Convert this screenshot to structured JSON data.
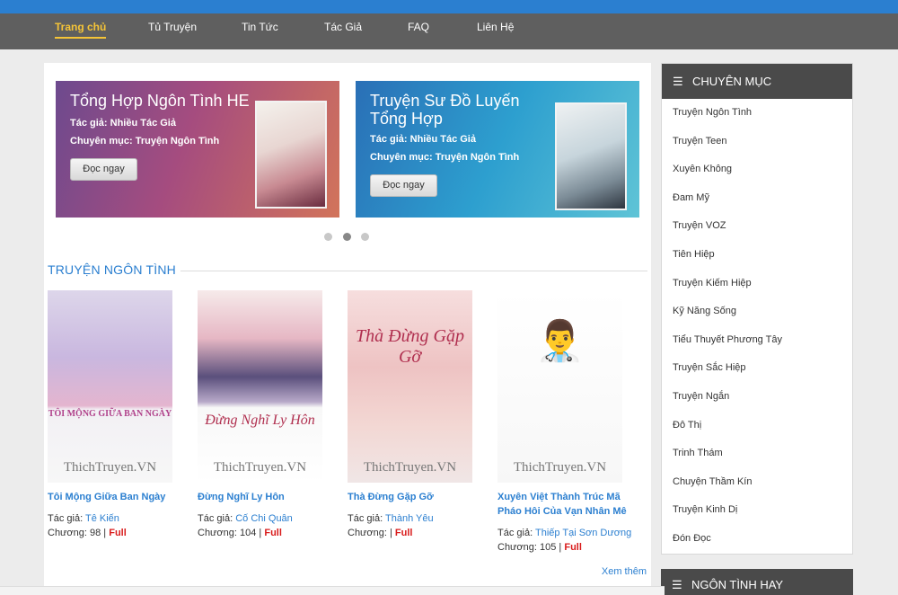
{
  "nav": {
    "items": [
      "Trang chủ",
      "Tủ Truyện",
      "Tin Tức",
      "Tác Giả",
      "FAQ",
      "Liên Hệ"
    ]
  },
  "slider": {
    "slides": [
      {
        "title": "Tổng Hợp Ngôn Tình HE",
        "author": "Tác giả: Nhiều Tác Giả",
        "category": "Chuyên mục: Truyện Ngôn Tình",
        "button": "Đọc ngay"
      },
      {
        "title": "Truyện Sư Đồ Luyến Tổng Hợp",
        "author": "Tác giả: Nhiều Tác Giả",
        "category": "Chuyên mục: Truyện Ngôn Tình",
        "button": "Đọc ngay"
      }
    ]
  },
  "section": {
    "title": "TRUYỆN NGÔN TÌNH",
    "more": "Xem thêm",
    "author_label": "Tác giả:",
    "chapter_label": "Chương:",
    "books": [
      {
        "title": "Tôi Mộng Giữa Ban Ngày",
        "author": "Tê Kiến",
        "chapters": "98",
        "status": "Full",
        "cover_text": "TÔI MỘNG GIỮA BAN NGÀY"
      },
      {
        "title": "Đừng Nghĩ Ly Hôn",
        "author": "Cố Chi Quân",
        "chapters": "104",
        "status": "Full",
        "cover_text": "Đừng Nghĩ Ly Hôn"
      },
      {
        "title": "Thà Đừng Gặp Gỡ",
        "author": "Thành Yêu",
        "chapters": "",
        "status": "Full",
        "cover_text": "Thà Đừng Gặp Gỡ"
      },
      {
        "title": "Xuyên Việt Thành Trúc Mã Pháo Hôi Của Vạn Nhân Mê",
        "author": "Thiếp Tại Sơn Dương",
        "chapters": "105",
        "status": "Full",
        "cover_text": ""
      }
    ],
    "watermark": "ThichTruyen.VN"
  },
  "sidebar": {
    "title": "CHUYÊN MỤC",
    "items": [
      "Truyện Ngôn Tình",
      "Truyện Teen",
      "Xuyên Không",
      "Đam Mỹ",
      "Truyện VOZ",
      "Tiên Hiệp",
      "Truyện Kiếm Hiệp",
      "Kỹ Năng Sống",
      "Tiểu Thuyết Phương Tây",
      "Truyện Sắc Hiệp",
      "Truyện Ngắn",
      "Đô Thị",
      "Trinh Thám",
      "Chuyện Thầm Kín",
      "Truyện Kinh Dị",
      "Đón Đọc"
    ],
    "second_title": "NGÔN TÌNH HAY"
  },
  "colors": {
    "accent": "#2b7fd0",
    "nav_bg": "#5f5f5f",
    "active": "#f5c437",
    "full": "#d91c1c"
  }
}
